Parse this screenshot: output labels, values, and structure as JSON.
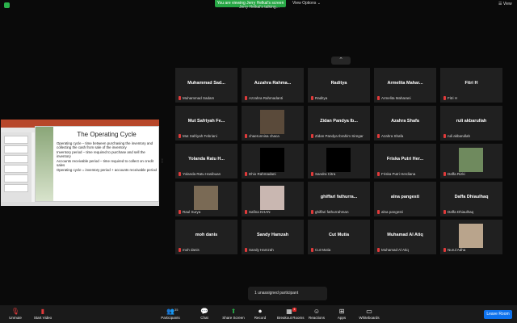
{
  "top": {
    "viewing_banner": "You are viewing Jerry Helkal's screen",
    "view_options": "View Options ⌄",
    "view_button": "☰ View",
    "speaker_label": "Jerry Helkal's talking..."
  },
  "shared_slide": {
    "title": "The Operating Cycle",
    "bullets": [
      "Operating cycle – time between purchasing the inventory and collecting the cash from sale of the inventory",
      "Inventory period – time required to purchase and sell the inventory",
      "Accounts receivable period – time required to collect on credit sales",
      "Operating cycle = inventory period + accounts receivable period"
    ]
  },
  "participants": [
    {
      "name": "Muhammad  Sad...",
      "label": "Muhammad Sadam"
    },
    {
      "name": "Azzahra  Rahma...",
      "label": "Azzahra Rahmadanti"
    },
    {
      "name": "Raditya",
      "label": "Raditya"
    },
    {
      "name": "Armelita  Mahar...",
      "label": "Armelita Maharani"
    },
    {
      "name": "Fitri H",
      "label": "Fitri H"
    },
    {
      "name": "Mut Safriyah Fe...",
      "label": "Mut Safriyah Febriani"
    },
    {
      "name": "",
      "label": "chaerunnisa chaca",
      "photo": "#5a4a3a"
    },
    {
      "name": "Zidan  Pandya  Ib...",
      "label": "Zidan Pandya Ibrahim Siregar"
    },
    {
      "name": "Azahra Shafa",
      "label": "Azahra Shafa"
    },
    {
      "name": "ruli akbarullah",
      "label": "ruli akbarullah"
    },
    {
      "name": "Yolanda Ratu H...",
      "label": "Yolanda Ratu Hasibuan"
    },
    {
      "name": "",
      "label": "Dhio Rahmadani",
      "photo": "#000000"
    },
    {
      "name": "",
      "label": "Sandra Citra",
      "photo": "#000000"
    },
    {
      "name": "Friska Putri Her...",
      "label": "Friska Putri Herdiana"
    },
    {
      "name": "",
      "label": "Daffa Rizki",
      "photo": "#6f8a5e"
    },
    {
      "name": "",
      "label": "Raul Surya",
      "photo": "#7a6a55"
    },
    {
      "name": "",
      "label": "Safina KHAN",
      "photo": "#c9b7b1"
    },
    {
      "name": "ghiffari  fathurra...",
      "label": "ghiffari fathurrahman"
    },
    {
      "name": "alna pangesti",
      "label": "alna pangesti"
    },
    {
      "name": "Daffa Dhiaulhaq",
      "label": "Daffa Dhiaulhaq"
    },
    {
      "name": "moh danis",
      "label": "moh danis"
    },
    {
      "name": "Sandy Hamzah",
      "label": "Sandy Hamzah"
    },
    {
      "name": "Cut Mutia",
      "label": "Cut Mutia"
    },
    {
      "name": "Muhamad Al Atiq",
      "label": "Muhamad Al Atiq"
    },
    {
      "name": "",
      "label": "Nurul Adha",
      "photo": "#b9a48c"
    }
  ],
  "unassigned": "1 unassigned participant",
  "toolbar": {
    "unmute": "Unmute",
    "start_video": "Start Video",
    "participants": "Participants",
    "participants_count": "35",
    "chat": "Chat",
    "share_screen": "Share Screen",
    "record": "Record",
    "breakout": "Breakout Rooms",
    "breakout_badge": "1",
    "reactions": "Reactions",
    "apps": "Apps",
    "whiteboards": "Whiteboards",
    "leave": "Leave Room"
  },
  "colors": {
    "accent": "#0e72ed",
    "share_green": "#27a745",
    "mute_red": "#e03a3a"
  }
}
